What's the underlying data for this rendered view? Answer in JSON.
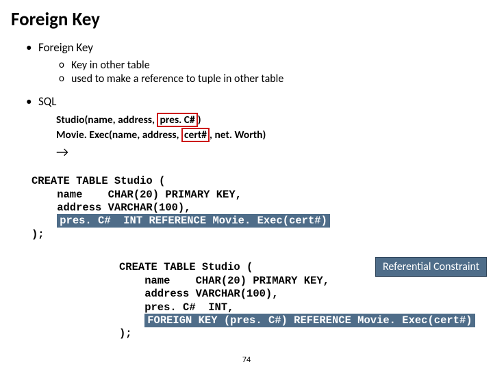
{
  "title": "Foreign Key",
  "bullets": {
    "fk": "Foreign Key",
    "sub1": "Key in other table",
    "sub2": "used to make a reference to tuple in other table",
    "sql": "SQL"
  },
  "schema": {
    "studio_pre": "Studio(name, address, ",
    "studio_key": "pres. C#",
    "studio_post": ")",
    "movie_pre": "Movie. Exec(name, address, ",
    "movie_key": "cert#",
    "movie_post": ", net. Worth)"
  },
  "arrow": "→",
  "code1": {
    "l1": "CREATE TABLE Studio (",
    "l2": "    name    CHAR(20) PRIMARY KEY,",
    "l3": "    address VARCHAR(100),",
    "l4_hl": "pres. C#  INT REFERENCE Movie. Exec(cert#)",
    "l5": ");"
  },
  "badge1": "Referential Constraint",
  "code2": {
    "l1": "CREATE TABLE Studio (",
    "l2": "    name    CHAR(20) PRIMARY KEY,",
    "l3": "    address VARCHAR(100),",
    "l4": "    pres. C#  INT,",
    "l5_hl": "FOREIGN KEY (pres. C#) REFERENCE Movie. Exec(cert#)",
    "l6": ");"
  },
  "pageno": "74"
}
